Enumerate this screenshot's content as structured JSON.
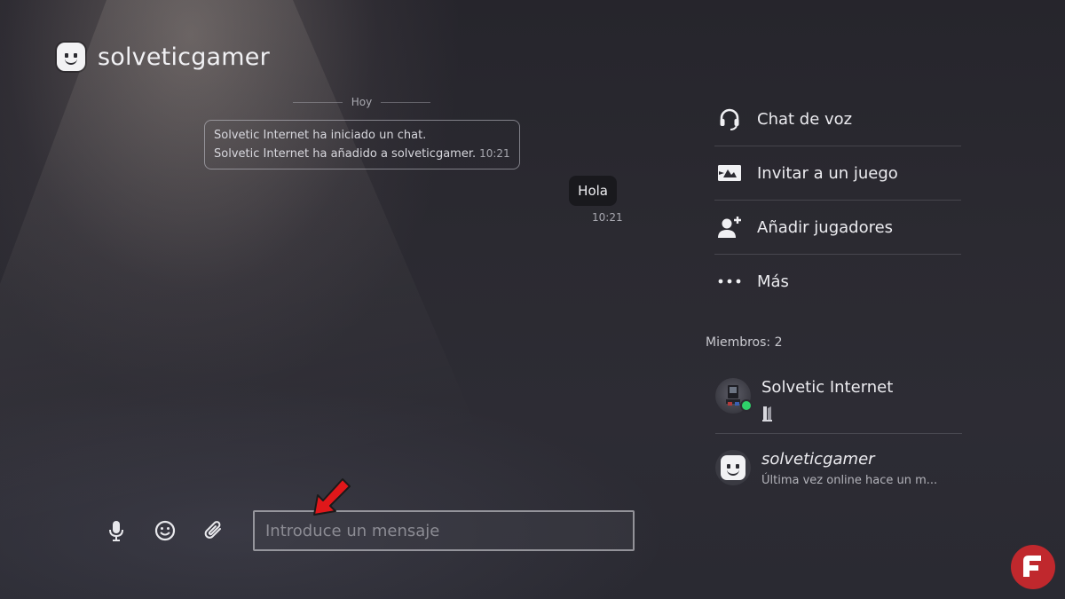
{
  "header": {
    "username": "solveticgamer",
    "avatar_icon": "bot-face-avatar"
  },
  "chat": {
    "date_divider": "Hoy",
    "system_messages": [
      "Solvetic Internet ha iniciado un chat.",
      "Solvetic Internet ha añadido a solveticgamer."
    ],
    "system_time": "10:21",
    "bubble": {
      "text": "Hola",
      "time": "10:21"
    }
  },
  "actions": [
    {
      "label": "Chat de voz",
      "icon": "headset-icon"
    },
    {
      "label": "Invitar a un juego",
      "icon": "invite-game-icon"
    },
    {
      "label": "Añadir jugadores",
      "icon": "add-player-icon"
    },
    {
      "label": "Más",
      "icon": "more-icon"
    }
  ],
  "members": {
    "label": "Miembros: 2",
    "list": [
      {
        "name": "Solvetic Internet",
        "status": "online",
        "status_color": "#2fd06a",
        "platform_icon": "ps5-console-icon"
      },
      {
        "name": "solveticgamer",
        "sub": "Última vez online hace un m..."
      }
    ]
  },
  "composer": {
    "placeholder": "Introduce un mensaje",
    "tools": [
      "microphone-icon",
      "emoji-icon",
      "attachment-icon"
    ]
  },
  "colors": {
    "annotation_arrow": "#e0171a",
    "watermark": "#c0282d"
  }
}
